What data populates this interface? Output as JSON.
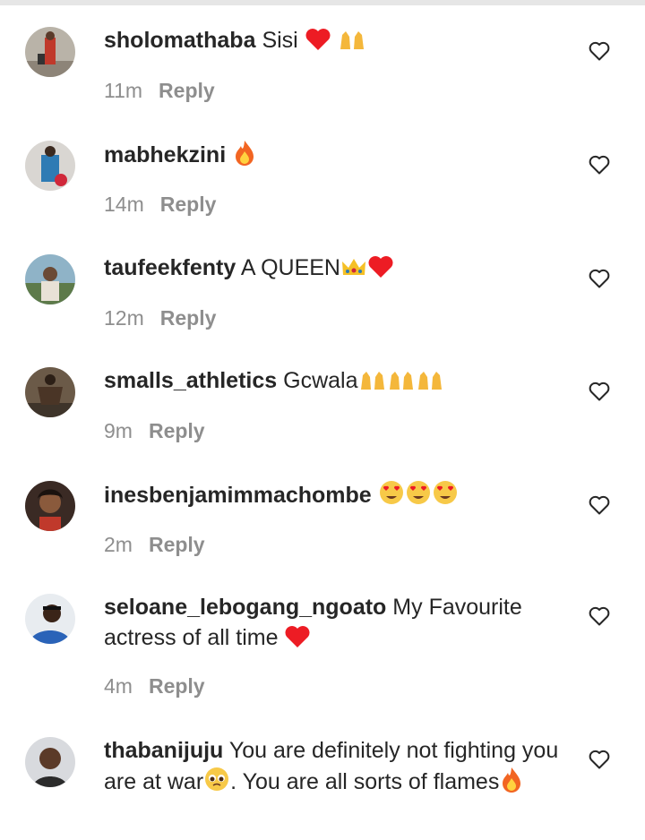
{
  "comments": [
    {
      "username": "sholomathaba",
      "text": "Sisi",
      "emoji": [
        "heart",
        "raising-hands"
      ],
      "time": "11m",
      "reply": "Reply",
      "avatar": "avatar-1"
    },
    {
      "username": "mabhekzini",
      "text": "",
      "emoji": [
        "fire"
      ],
      "time": "14m",
      "reply": "Reply",
      "avatar": "avatar-2"
    },
    {
      "username": "taufeekfenty",
      "text": "A QUEEN",
      "emoji": [
        "crown",
        "heart"
      ],
      "time": "12m",
      "reply": "Reply",
      "avatar": "avatar-3"
    },
    {
      "username": "smalls_athletics",
      "text": "Gcwala",
      "emoji": [
        "raising-hands",
        "raising-hands",
        "raising-hands"
      ],
      "time": "9m",
      "reply": "Reply",
      "avatar": "avatar-4"
    },
    {
      "username": "inesbenjamimmachombe",
      "text": "",
      "emoji": [
        "heart-eyes",
        "heart-eyes",
        "heart-eyes"
      ],
      "time": "2m",
      "reply": "Reply",
      "avatar": "avatar-5"
    },
    {
      "username": "seloane_lebogang_ngoato",
      "text": "My Favourite actress of all time",
      "emoji": [
        "heart"
      ],
      "time": "4m",
      "reply": "Reply",
      "avatar": "avatar-6"
    },
    {
      "username": "thabanijuju",
      "text": "You are definitely not fighting you are at war",
      "text2": ". You are all sorts of flames",
      "emoji": [
        "pleading-face"
      ],
      "emoji2": [
        "fire"
      ],
      "time": "",
      "reply": "",
      "avatar": "avatar-7"
    }
  ],
  "colors": {
    "text": "#262626",
    "muted": "#8e8e8e",
    "heart": "#ed1c24"
  },
  "icons": {
    "like": "heart-outline-icon"
  }
}
